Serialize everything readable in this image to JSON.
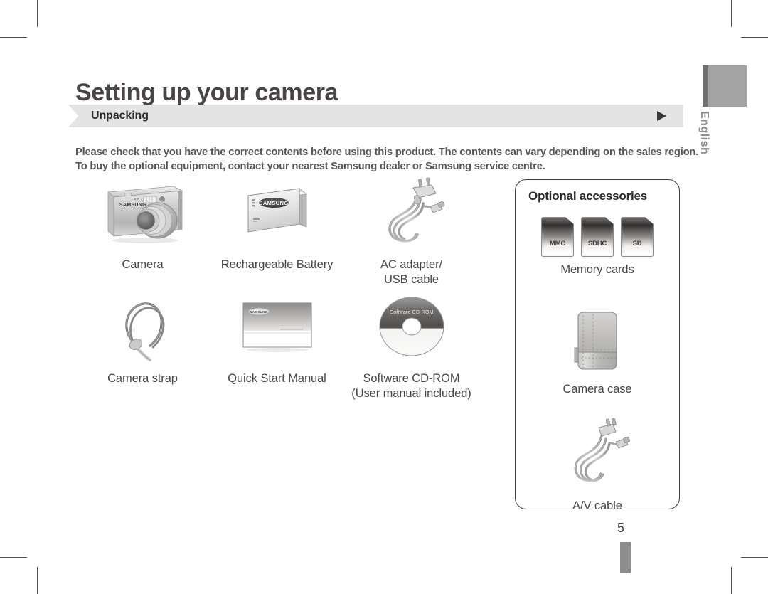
{
  "page": {
    "title": "Setting up your camera",
    "number": "5",
    "language_tab": "English"
  },
  "section": {
    "label": "Unpacking",
    "arrow_icon": "triangle-right-icon"
  },
  "intro": {
    "line1": "Please check that you have the correct contents before using this product. The contents can vary depending on the sales region.",
    "line2": "To buy the optional equipment, contact your nearest Samsung dealer or Samsung service centre."
  },
  "items": [
    [
      {
        "label": "Camera",
        "icon": "camera-icon"
      },
      {
        "label": "Rechargeable Battery",
        "icon": "battery-icon"
      },
      {
        "label": "AC adapter/\nUSB cable",
        "label_line1": "AC adapter/",
        "label_line2": "USB cable",
        "icon": "ac-adapter-usb-cable-icon"
      }
    ],
    [
      {
        "label": "Camera strap",
        "icon": "camera-strap-icon"
      },
      {
        "label": "Quick Start Manual",
        "icon": "quick-start-manual-icon"
      },
      {
        "label": "Software CD-ROM\n(User manual included)",
        "label_line1": "Software CD-ROM",
        "label_line2": "(User manual included)",
        "icon": "software-cd-rom-icon"
      }
    ]
  ],
  "optional": {
    "title": "Optional accessories",
    "memory_cards": {
      "label": "Memory cards",
      "cards": [
        {
          "text": "MMC"
        },
        {
          "text": "SDHC"
        },
        {
          "text": "SD"
        }
      ]
    },
    "camera_case": {
      "label": "Camera case",
      "icon": "camera-case-icon"
    },
    "av_cable": {
      "label": "A/V cable",
      "icon": "av-cable-icon"
    }
  },
  "artwork": {
    "cd_label": "Software CD-ROM",
    "samsung_wordmark": "SAMSUNG"
  },
  "colors": {
    "text": "#4a4446",
    "section_bar": "#e4e4e4",
    "lang_tab": "#a3a3a3",
    "panel_border": "#3f3a3c"
  }
}
